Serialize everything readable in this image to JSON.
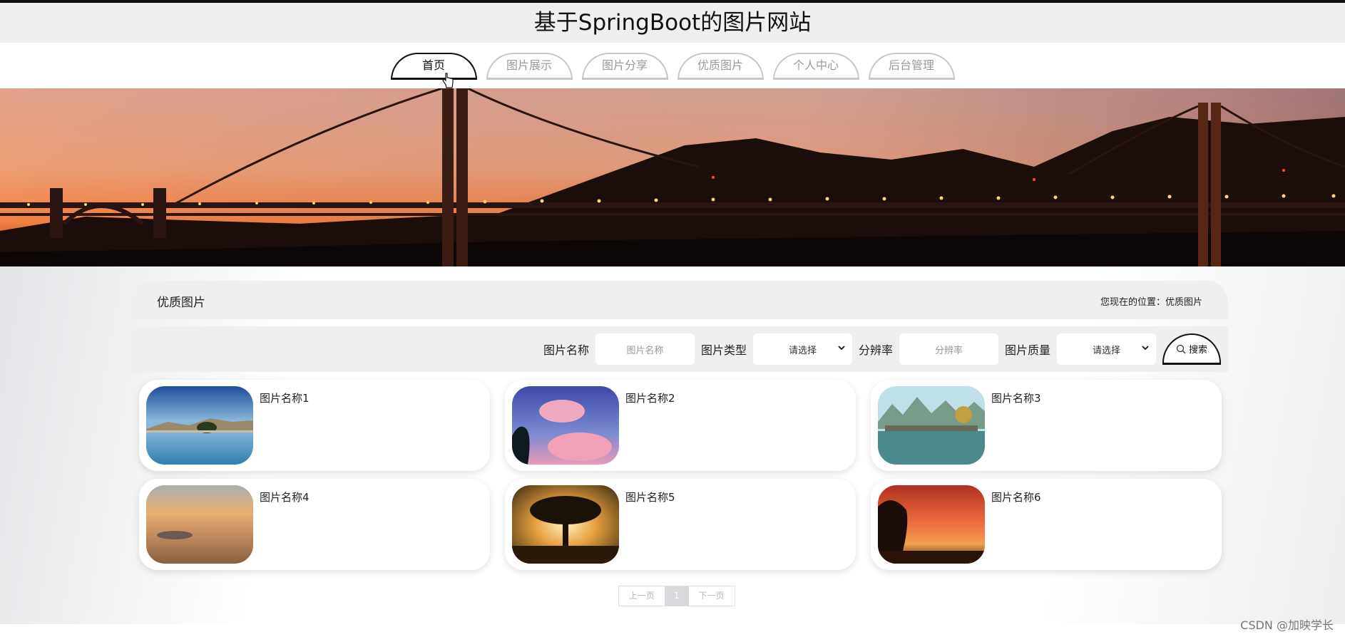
{
  "site": {
    "title": "基于SpringBoot的图片网站"
  },
  "nav": [
    {
      "label": "首页",
      "active": true
    },
    {
      "label": "图片展示",
      "active": false
    },
    {
      "label": "图片分享",
      "active": false
    },
    {
      "label": "优质图片",
      "active": false
    },
    {
      "label": "个人中心",
      "active": false
    },
    {
      "label": "后台管理",
      "active": false
    }
  ],
  "breadcrumb": {
    "title": "优质图片",
    "location": "您现在的位置：优质图片"
  },
  "filters": {
    "name_label": "图片名称",
    "name_placeholder": "图片名称",
    "type_label": "图片类型",
    "type_value": "请选择",
    "resolution_label": "分辨率",
    "resolution_placeholder": "分辨率",
    "quality_label": "图片质量",
    "quality_value": "请选择",
    "search_label": "搜索"
  },
  "cards": [
    {
      "name": "图片名称1",
      "image": "lake-reflection"
    },
    {
      "name": "图片名称2",
      "image": "pink-clouds"
    },
    {
      "name": "图片名称3",
      "image": "karst-bridge"
    },
    {
      "name": "图片名称4",
      "image": "golden-sunset-sea"
    },
    {
      "name": "图片名称5",
      "image": "tree-sunburst"
    },
    {
      "name": "图片名称6",
      "image": "red-sunset-coast"
    }
  ],
  "pagination": {
    "prev": "上一页",
    "current": "1",
    "next": "下一页"
  },
  "watermark": "CSDN @加映学长",
  "colors": {
    "header_bg": "#eeeff1",
    "active_nav": "#111111",
    "inactive_nav": "#9a9a9a"
  }
}
